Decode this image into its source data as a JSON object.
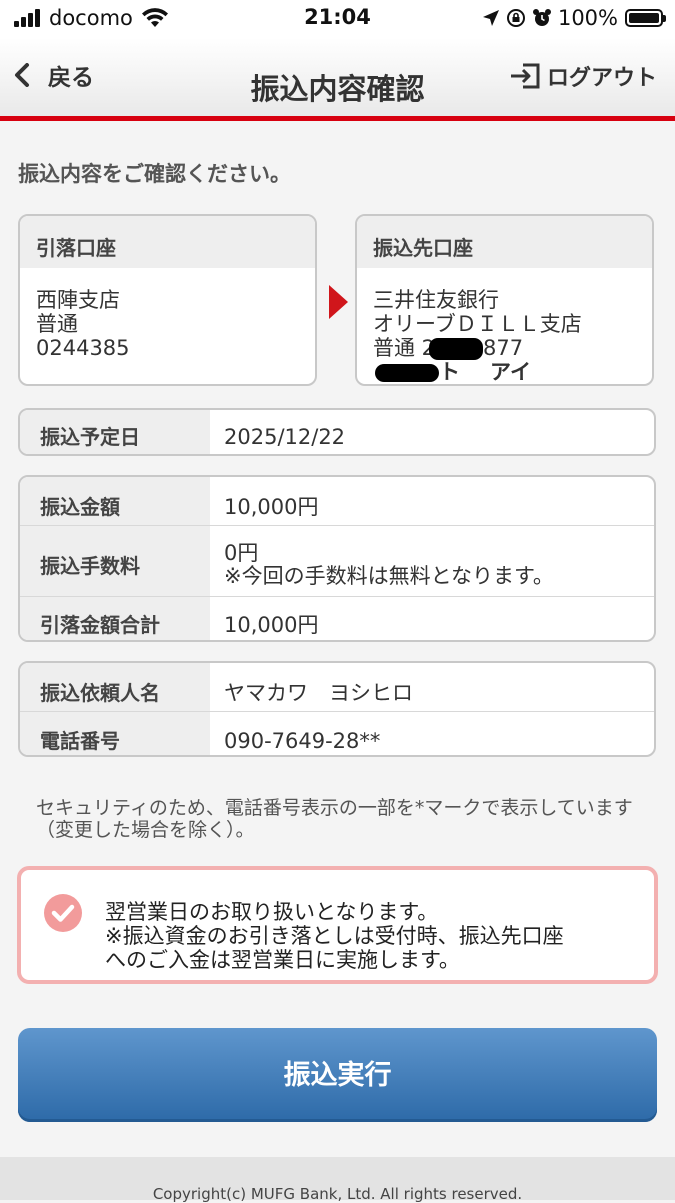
{
  "status_bar": {
    "carrier": "docomo",
    "time": "21:04",
    "battery": "100%",
    "battery_level": 1.0
  },
  "header": {
    "back_label": "戻る",
    "title": "振込内容確認",
    "logout_label": "ログアウト"
  },
  "intro": "振込内容をご確認ください。",
  "from_account": {
    "heading": "引落口座",
    "branch": "西陣支店",
    "type": "普通",
    "number": "0244385"
  },
  "to_account": {
    "heading": "振込先口座",
    "bank": "三井住友銀行",
    "branch": "オリーブＤＩＬＬ支店",
    "type_number_prefix": "普通 2",
    "type_number_suffix": "877",
    "name_partial_1": "ト",
    "name_partial_2": "アイ"
  },
  "schedule": {
    "label": "振込予定日",
    "value": "2025/12/22"
  },
  "amounts": {
    "amount_label": "振込金額",
    "amount_value": "10,000円",
    "fee_label": "振込手数料",
    "fee_value": "0円",
    "fee_note": "※今回の手数料は無料となります。",
    "total_label": "引落金額合計",
    "total_value": "10,000円"
  },
  "requester": {
    "name_label": "振込依頼人名",
    "name_value": "ヤマカワ　ヨシヒロ",
    "phone_label": "電話番号",
    "phone_value": "090-7649-28**"
  },
  "security_note": "セキュリティのため、電話番号表示の一部を*マークで表示しています（変更した場合を除く）。",
  "notice": {
    "line1": "翌営業日のお取り扱いとなります。",
    "line2": "※振込資金のお引き落としは受付時、振込先口座",
    "line3": "へのご入金は翌営業日に実施します。"
  },
  "execute_button": "振込実行",
  "footer": {
    "copyright": "Copyright(c) MUFG Bank, Ltd. All rights reserved."
  },
  "colors": {
    "accent_red": "#d7000f",
    "button_blue": "#3e79b8",
    "notice_border": "#f3b0b0"
  }
}
